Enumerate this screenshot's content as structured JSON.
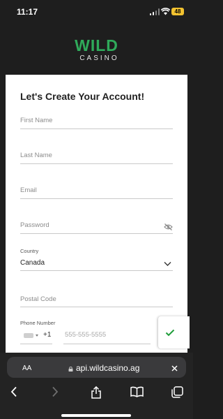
{
  "status_bar": {
    "time": "11:17",
    "battery": "48"
  },
  "logo": {
    "top": "WILD",
    "bottom": "CASINO"
  },
  "form": {
    "title": "Let's Create Your Account!",
    "first_name_placeholder": "First Name",
    "last_name_placeholder": "Last Name",
    "email_placeholder": "Email",
    "password_placeholder": "Password",
    "country_label": "Country",
    "country_value": "Canada",
    "postal_code_placeholder": "Postal Code",
    "phone_label": "Phone Number",
    "phone_code": "+1",
    "phone_placeholder": "555-555-5555"
  },
  "browser": {
    "aa_label": "AA",
    "url": "api.wildcasino.ag"
  },
  "colors": {
    "brand_green": "#2faa5a",
    "check_green": "#1f9d3a",
    "background": "#1e1e1e"
  }
}
